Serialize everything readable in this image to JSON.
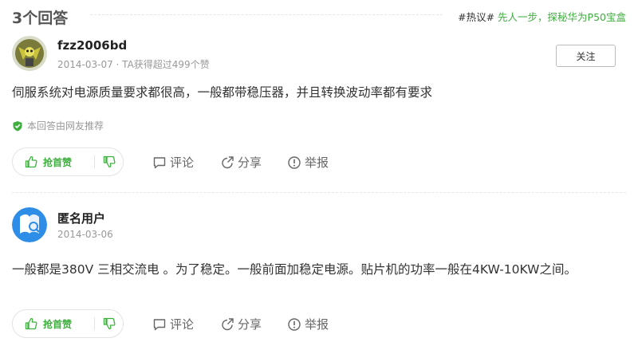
{
  "header": {
    "title": "3个回答",
    "hot_tag": "#热议#",
    "hot_text": "先人一步，探秘华为P50宝盒"
  },
  "answers": [
    {
      "username": "fzz2006bd",
      "meta": "2014-03-07 · TA获得超过499个赞",
      "follow_label": "关注",
      "content": "伺服系统对电源质量要求都很高，一般都带稳压器，并且转换波动率都有要求",
      "recommend": "本回答由网友推荐",
      "upvote_label": "抢首赞",
      "comment_label": "评论",
      "share_label": "分享",
      "report_label": "举报"
    },
    {
      "username": "匿名用户",
      "meta": "2014-03-06",
      "content": "一般都是380V 三相交流电 。为了稳定。一般前面加稳定电源。贴片机的功率一般在4KW-10KW之间。",
      "upvote_label": "抢首赞",
      "comment_label": "评论",
      "share_label": "分享",
      "report_label": "举报"
    }
  ],
  "colors": {
    "accent_green": "#3eaf3e",
    "anon_avatar_blue": "#2e8de6"
  },
  "icons": [
    "thumbs-up-icon",
    "thumbs-down-icon",
    "comment-icon",
    "share-icon",
    "report-icon",
    "shield-check-icon"
  ]
}
